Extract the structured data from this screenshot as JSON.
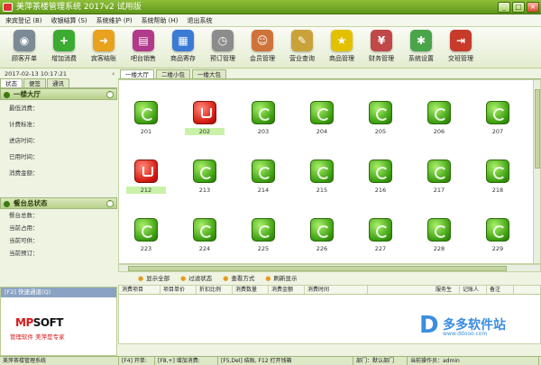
{
  "window": {
    "title": "美萍茶楼管理系统 2017v2 试用版"
  },
  "menu": [
    "来宾登记 (B)",
    "收银结算 (S)",
    "系统维护 (P)",
    "系统帮助 (H)",
    "退出系统"
  ],
  "toolbar": [
    {
      "label": "顾客开单",
      "icon": "pot-icon",
      "color": "#7b8a95"
    },
    {
      "label": "增加消费",
      "icon": "plus-icon",
      "color": "#3cab32"
    },
    {
      "label": "宾客结账",
      "icon": "checkout-icon",
      "color": "#e8a21e"
    },
    {
      "label": "吧台销售",
      "icon": "bar-icon",
      "color": "#b23a8a"
    },
    {
      "label": "商品寄存",
      "icon": "basket-icon",
      "color": "#3a7bd5"
    },
    {
      "label": "预订管理",
      "icon": "clock-icon",
      "color": "#8c8c8c"
    },
    {
      "label": "会员管理",
      "icon": "members-icon",
      "color": "#d0733a"
    },
    {
      "label": "营业查询",
      "icon": "broom-icon",
      "color": "#caa23a"
    },
    {
      "label": "商品管理",
      "icon": "star-icon",
      "color": "#e3c100"
    },
    {
      "label": "财务管理",
      "icon": "finance-icon",
      "color": "#c04848"
    },
    {
      "label": "系统设置",
      "icon": "gear-icon",
      "color": "#4aa54a"
    },
    {
      "label": "交班管理",
      "icon": "exit-door-icon",
      "color": "#c83a2a"
    }
  ],
  "left": {
    "datetime": "2017-02-13 10:17:21",
    "tabs": [
      "状态",
      "便签",
      "通讯"
    ],
    "hall_title": "一楼大厅",
    "fields": [
      "最低消费：",
      "计费标准：",
      "进店时间：",
      "已用时间：",
      "消费金额："
    ],
    "summary_title": "餐台总状态",
    "summary": [
      "餐台总数：",
      "当前占用：",
      "当前可供：",
      "当前预订："
    ],
    "quick": "[F2] 快速通道(Q)",
    "brand_prefix": "MP",
    "brand_suffix": "SOFT",
    "slogan": "管理软件  美萍是专家"
  },
  "main": {
    "tabs": [
      "一楼大厅",
      "二楼小包",
      "一楼大包"
    ],
    "tables": [
      {
        "num": "201",
        "busy": false
      },
      {
        "num": "202",
        "busy": true,
        "sel": true
      },
      {
        "num": "203",
        "busy": false
      },
      {
        "num": "204",
        "busy": false
      },
      {
        "num": "205",
        "busy": false
      },
      {
        "num": "206",
        "busy": false
      },
      {
        "num": "207",
        "busy": false
      },
      {
        "num": "212",
        "busy": true,
        "sel": true
      },
      {
        "num": "213",
        "busy": false
      },
      {
        "num": "214",
        "busy": false
      },
      {
        "num": "215",
        "busy": false
      },
      {
        "num": "216",
        "busy": false
      },
      {
        "num": "217",
        "busy": false
      },
      {
        "num": "218",
        "busy": false
      },
      {
        "num": "223",
        "busy": false
      },
      {
        "num": "224",
        "busy": false
      },
      {
        "num": "225",
        "busy": false
      },
      {
        "num": "226",
        "busy": false
      },
      {
        "num": "227",
        "busy": false
      },
      {
        "num": "228",
        "busy": false
      },
      {
        "num": "229",
        "busy": false
      }
    ],
    "actions": [
      "显示全部",
      "过滤状态",
      "查看方式",
      "刷新显示"
    ],
    "columns": [
      "消费项目",
      "项目单价",
      "折扣比例",
      "消费数量",
      "消费金额",
      "消费时间",
      "服务生",
      "记账人",
      "备注"
    ]
  },
  "watermark": {
    "d": "D",
    "text": "多多软件站",
    "url": "www.ddooo.com"
  },
  "status": [
    "美萍茶楼管理系统",
    "[F4] 开单:",
    "[F8,+] 增加消费:",
    "[F5,Del] 结账, F12 打开钱箱",
    "部门：默认部门",
    "当前操作员：admin"
  ]
}
